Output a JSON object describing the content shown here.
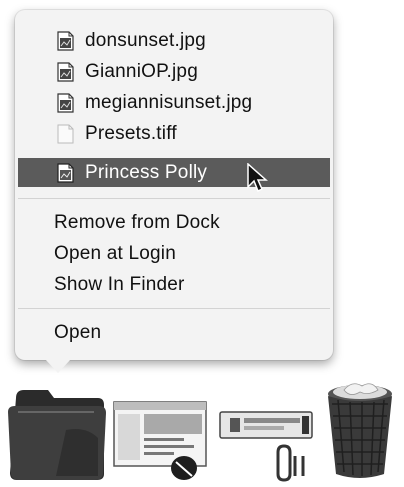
{
  "menu": {
    "files": [
      {
        "label": "donsunset.jpg",
        "icon": "image-file-icon"
      },
      {
        "label": "GianniOP.jpg",
        "icon": "image-file-icon"
      },
      {
        "label": "megiannisunset.jpg",
        "icon": "image-file-icon"
      },
      {
        "label": "Presets.tiff",
        "icon": "blank-file-icon"
      },
      {
        "label": "Princess Polly",
        "icon": "image-file-icon",
        "highlighted": true
      }
    ],
    "actions": [
      {
        "label": "Remove from Dock"
      },
      {
        "label": "Open at Login"
      },
      {
        "label": "Show In Finder"
      }
    ],
    "open": {
      "label": "Open"
    }
  },
  "dock": {
    "items": [
      {
        "name": "folder",
        "icon": "folder-icon"
      },
      {
        "name": "preview-window",
        "icon": "window-thumbnail-icon"
      },
      {
        "name": "application",
        "icon": "app-icon"
      },
      {
        "name": "trash",
        "icon": "trash-icon"
      }
    ]
  },
  "colors": {
    "menu_background": "#f3f3f3",
    "highlight": "#5b5b5b",
    "text": "#111111"
  }
}
